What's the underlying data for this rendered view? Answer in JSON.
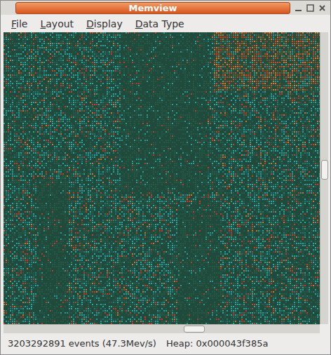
{
  "window": {
    "title": "Memview"
  },
  "menus": [
    {
      "label": "File"
    },
    {
      "label": "Layout"
    },
    {
      "label": "Display"
    },
    {
      "label": "Data Type"
    }
  ],
  "scrollbars": {
    "vertical": {
      "level": 0.47
    },
    "horizontal": {
      "level": 0.61
    }
  },
  "status_bar": {
    "events": "3203292891 events (47.3Mev/s)",
    "heap": "Heap: 0x000043f385a"
  }
}
